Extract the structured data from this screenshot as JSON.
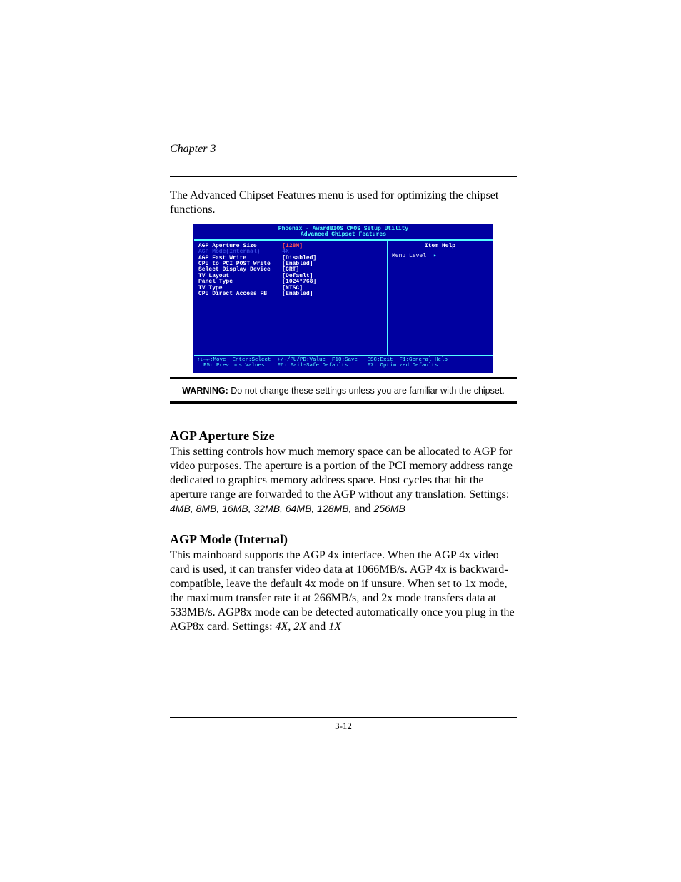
{
  "header": {
    "chapter": "Chapter 3"
  },
  "intro": "The Advanced Chipset Features menu is used for optimizing the chipset functions.",
  "bios": {
    "title1": "Phoenix - AwardBIOS CMOS Setup Utility",
    "title2": "Advanced Chipset Features",
    "rows": [
      {
        "label": "AGP Aperture Size",
        "value": "[128M]",
        "style": "sel"
      },
      {
        "label": "AGP Mode(Internal)",
        "value": "4X",
        "style": "dim"
      },
      {
        "label": "AGP Fast Write",
        "value": "[Disabled]",
        "style": "norm"
      },
      {
        "label": "CPU to PCI POST Write",
        "value": "[Enabled]",
        "style": "norm"
      },
      {
        "label": "Select Display Device",
        "value": "[CRT]",
        "style": "norm"
      },
      {
        "label": "TV Layout",
        "value": "[Default]",
        "style": "norm"
      },
      {
        "label": "Panel Type",
        "value": "[1024*768]",
        "style": "norm"
      },
      {
        "label": "TV Type",
        "value": "[NTSC]",
        "style": "norm"
      },
      {
        "label": "CPU Direct Access FB",
        "value": "[Enabled]",
        "style": "norm"
      }
    ],
    "help_title": "Item Help",
    "menu_level_label": "Menu Level",
    "menu_level_arrow": "▸",
    "footer_line1": "↑↓→←:Move  Enter:Select  +/-/PU/PD:Value  F10:Save   ESC:Exit  F1:General Help",
    "footer_line2": "  F5: Previous Values    F6: Fail-Safe Defaults      F7: Optimized Defaults"
  },
  "warning": {
    "label": "WARNING:",
    "text": " Do not change these settings unless you are familiar with the chipset."
  },
  "sections": {
    "agp_aperture": {
      "title": "AGP Aperture Size",
      "body": "This setting controls how much memory space can be allocated to AGP for video purposes. The aperture is a portion of the PCI memory address range dedicated to graphics memory address space. Host cycles that hit the aperture range are forwarded to the AGP without any translation. Settings: ",
      "settings_left": "4MB, 8MB, 16MB, 32MB, 64MB, 128MB,",
      "settings_join": " and ",
      "settings_right": "256MB"
    },
    "agp_mode": {
      "title": "AGP Mode (Internal)",
      "body_pre": "This mainboard supports the AGP 4x interface. When the AGP 4x video card is used, it can transfer video data at 1066MB/s. AGP 4x is backward-compatible, leave the default 4x mode on if unsure. When set to 1x mode, the maximum transfer rate it at 266MB/s, and 2x mode transfers data at 533MB/s. AGP8x mode can be detected automatically once you plug in the AGP8x card. Settings: ",
      "s1": "4X",
      "s2": "2X",
      "s3": "1X",
      "comma": ", ",
      "and": " and "
    }
  },
  "footer": {
    "page": "3-12"
  }
}
